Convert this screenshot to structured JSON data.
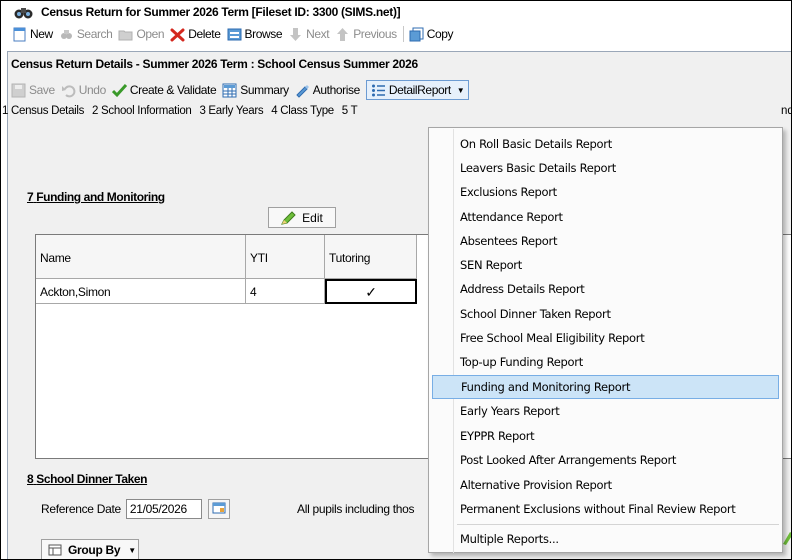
{
  "window": {
    "title": "Census Return for Summer 2026 Term [Fileset ID: 3300 (SIMS.net)]"
  },
  "main_toolbar": {
    "new": "New",
    "search": "Search",
    "open": "Open",
    "delete": "Delete",
    "browse": "Browse",
    "next": "Next",
    "previous": "Previous",
    "copy": "Copy"
  },
  "details": {
    "heading": "Census Return Details - Summer 2026 Term : School Census Summer 2026",
    "toolbar": {
      "save": "Save",
      "undo": "Undo",
      "create_validate": "Create & Validate",
      "summary": "Summary",
      "authorise": "Authorise",
      "detail_report": "DetailReport"
    },
    "tabs": [
      "1 Census Details",
      "2 School Information",
      "3 Early Years",
      "4 Class Type",
      "5 T"
    ],
    "tabs_tail": "nd"
  },
  "section7": {
    "number": "7",
    "title": "Funding and Monitoring",
    "edit_label": "Edit",
    "columns": [
      "Name",
      "YTI",
      "Tutoring"
    ],
    "rows": [
      {
        "name": "Ackton,Simon",
        "yti": "4",
        "tutoring": "✓"
      }
    ]
  },
  "section8": {
    "number": "8",
    "title": "School Dinner Taken",
    "reference_date_label": "Reference Date",
    "reference_date_value": "21/05/2026",
    "note": "All pupils including thos",
    "group_by_label": "Group By"
  },
  "detail_report_menu": {
    "items": [
      "On Roll Basic Details Report",
      "Leavers Basic Details Report",
      "Exclusions Report",
      "Attendance Report",
      "Absentees Report",
      "SEN Report",
      "Address Details Report",
      "School Dinner Taken Report",
      "Free School Meal Eligibility Report",
      "Top-up Funding Report",
      "Funding and Monitoring Report",
      "Early Years Report",
      "EYPPR Report",
      "Post Looked After Arrangements Report",
      "Alternative Provision Report",
      "Permanent Exclusions without Final Review Report",
      "Multiple Reports..."
    ],
    "highlighted": "Funding and Monitoring Report"
  },
  "colors": {
    "highlight": "#cce4f7",
    "highlight_border": "#78aee5",
    "delete_red": "#d4281e",
    "check_green": "#3a9a2a"
  }
}
